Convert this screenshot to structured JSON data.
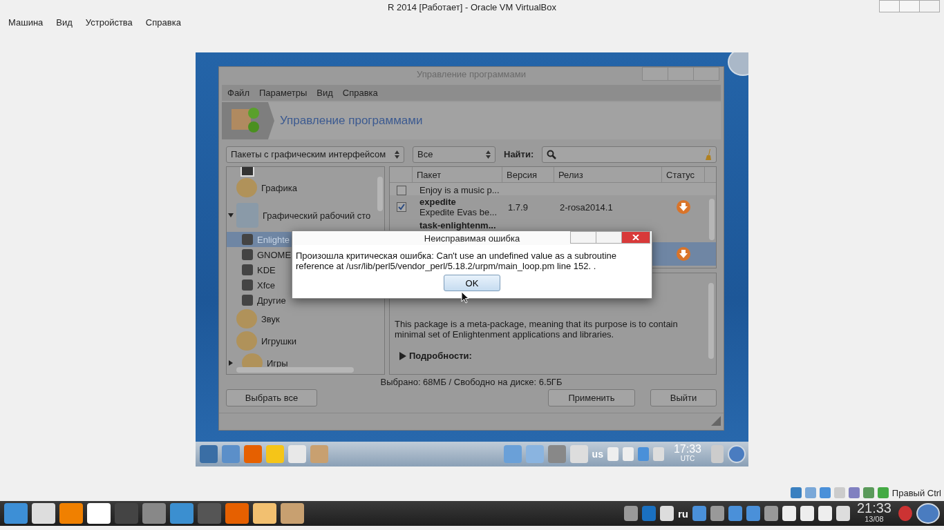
{
  "host_window": {
    "title": "R 2014 [Работает] - Oracle VM VirtualBox",
    "menu": [
      "Машина",
      "Вид",
      "Устройства",
      "Справка"
    ]
  },
  "app_window": {
    "title": "Управление программами",
    "menu": [
      "Файл",
      "Параметры",
      "Вид",
      "Справка"
    ],
    "header_title": "Управление программами",
    "filter_dropdown": "Пакеты с графическим интерфейсом",
    "type_dropdown": "Все",
    "search_label": "Найти:",
    "categories": [
      {
        "label": "Графика",
        "selected": false
      },
      {
        "label": "Графический рабочий сто",
        "selected": false,
        "expanded": true,
        "children": [
          {
            "label": "Enlighte",
            "selected": true
          },
          {
            "label": "GNOME",
            "selected": false
          },
          {
            "label": "KDE",
            "selected": false
          },
          {
            "label": "Xfce",
            "selected": false
          },
          {
            "label": "Другие",
            "selected": false
          }
        ]
      },
      {
        "label": "Звук",
        "selected": false
      },
      {
        "label": "Игрушки",
        "selected": false
      },
      {
        "label": "Игры",
        "selected": false,
        "expanded": false
      }
    ],
    "table": {
      "columns": [
        "Пакет",
        "Версия",
        "Релиз",
        "Статус"
      ],
      "rows": [
        {
          "description": "Enjoy is a music p...",
          "checked": false,
          "selected": false
        },
        {
          "name": "expedite",
          "description": "Expedite Evas be...",
          "version": "1.7.9",
          "release": "2-rosa2014.1",
          "checked": true,
          "selected": false,
          "download": true
        },
        {
          "name": "task-enlightenm...",
          "selected": false
        },
        {
          "selected": true,
          "download": true
        }
      ]
    },
    "description": "This package is a meta-package, meaning that its purpose is to contain minimal set of Enlightenment applications and libraries.",
    "details_label": "Подробности:",
    "status": "Выбрано: 68МБ / Свободно на диске: 6.5ГБ",
    "buttons": {
      "select_all": "Выбрать все",
      "apply": "Применить",
      "quit": "Выйти"
    }
  },
  "dialog": {
    "title": "Неисправимая ошибка",
    "message": "Произошла критическая ошибка: Can't use an undefined value as a subroutine reference at /usr/lib/perl5/vendor_perl/5.18.2/urpm/main_loop.pm line 152. .",
    "ok": "OK"
  },
  "guest_panel": {
    "keyboard": "us",
    "clock": "17:33",
    "timezone": "UTC"
  },
  "host_status": {
    "host_key": "Правый Ctrl"
  },
  "host_taskbar": {
    "keyboard": "ru",
    "clock": "21:33",
    "date": "13/08"
  }
}
